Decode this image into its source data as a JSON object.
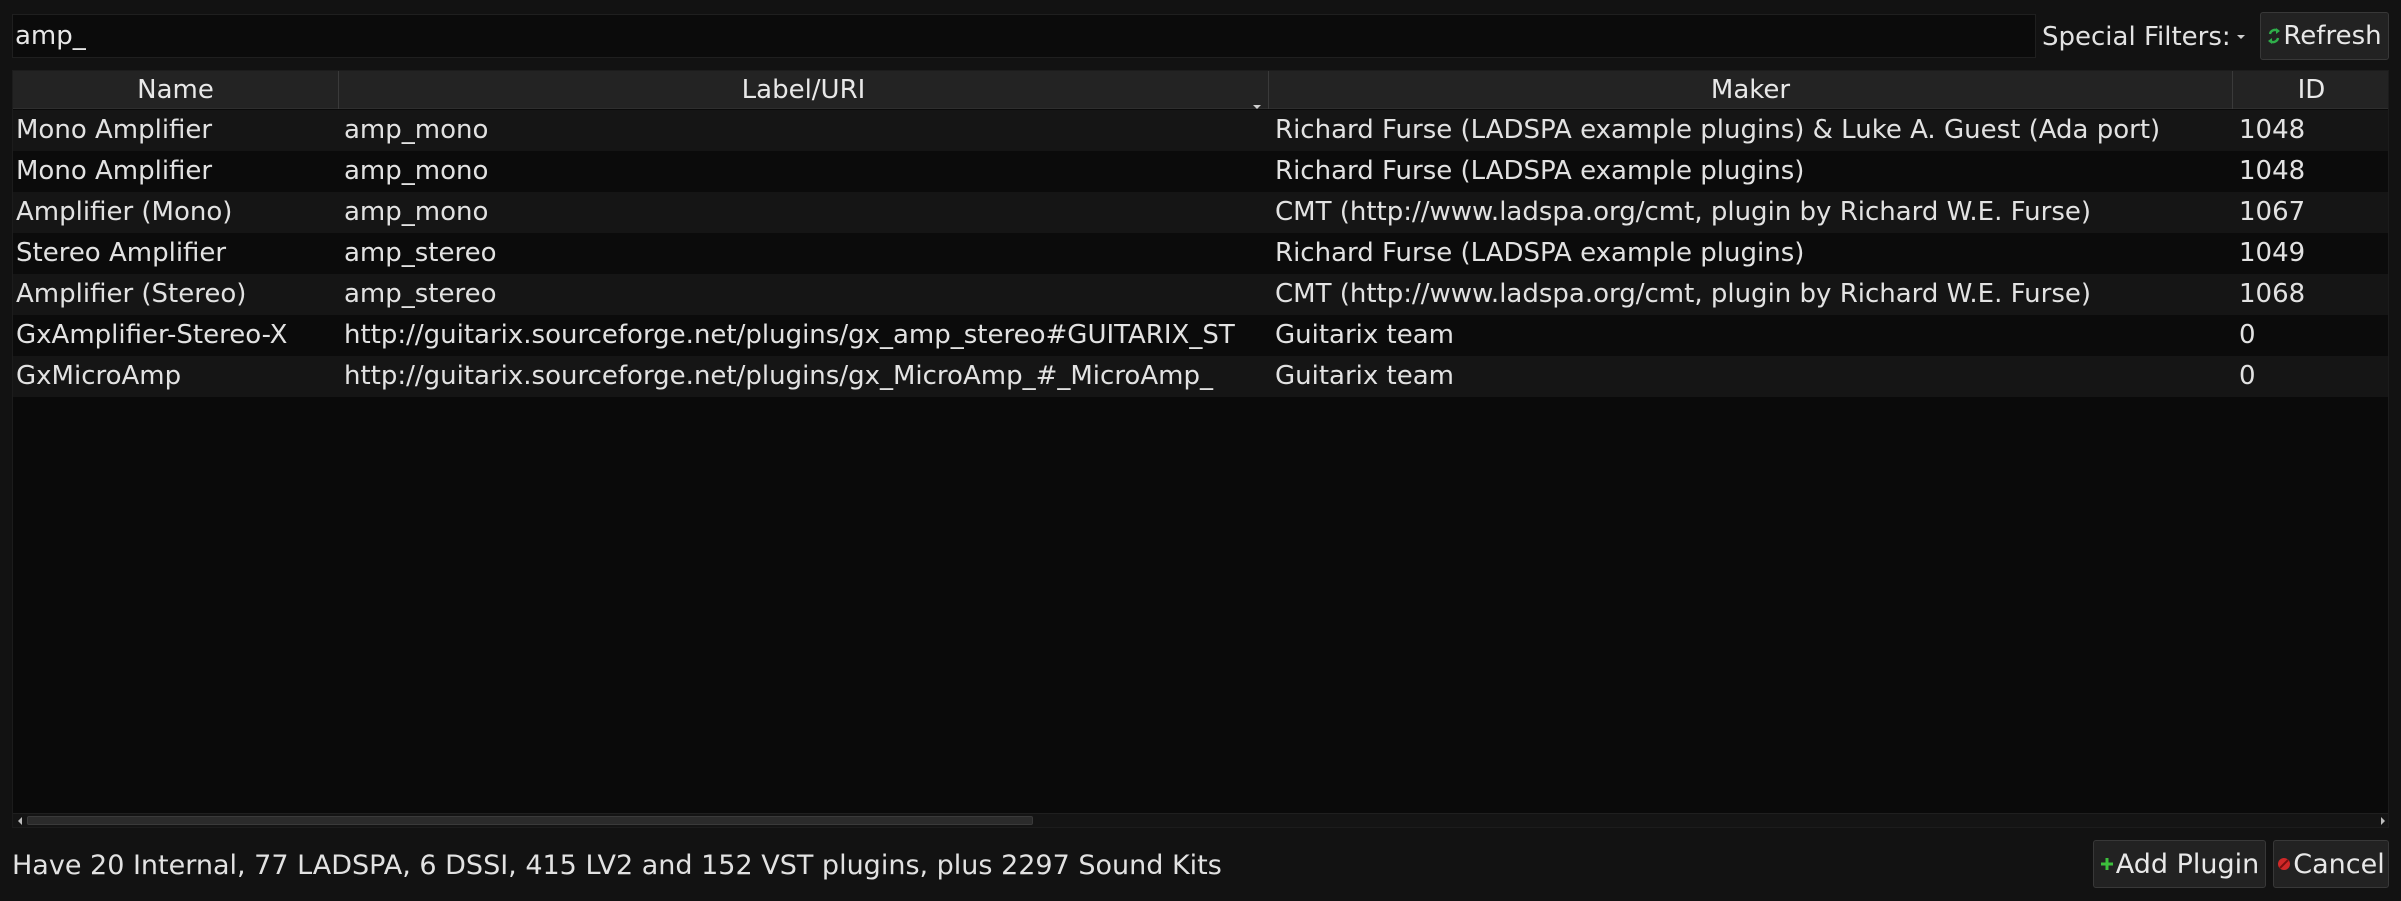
{
  "search": {
    "value": "amp_"
  },
  "filters": {
    "label": "Special Filters:",
    "icon": "chevron-down-icon"
  },
  "toolbar": {
    "refresh_label": "Refresh",
    "refresh_icon": "refresh-icon"
  },
  "table": {
    "columns": [
      "Name",
      "Label/URI",
      "Maker",
      "ID"
    ],
    "sorted_column": "Label/URI",
    "rows": [
      {
        "name": "Mono Amplifier",
        "label": "amp_mono",
        "maker": "Richard Furse (LADSPA example plugins) & Luke A. Guest (Ada port)",
        "id": "1048"
      },
      {
        "name": "Mono Amplifier",
        "label": "amp_mono",
        "maker": "Richard Furse (LADSPA example plugins)",
        "id": "1048"
      },
      {
        "name": "Amplifier (Mono)",
        "label": "amp_mono",
        "maker": "CMT (http://www.ladspa.org/cmt, plugin by Richard W.E. Furse)",
        "id": "1067"
      },
      {
        "name": "Stereo Amplifier",
        "label": "amp_stereo",
        "maker": "Richard Furse (LADSPA example plugins)",
        "id": "1049"
      },
      {
        "name": "Amplifier (Stereo)",
        "label": "amp_stereo",
        "maker": "CMT (http://www.ladspa.org/cmt, plugin by Richard W.E. Furse)",
        "id": "1068"
      },
      {
        "name": "GxAmplifier-Stereo-X",
        "label": "http://guitarix.sourceforge.net/plugins/gx_amp_stereo#GUITARIX_ST",
        "maker": "Guitarix team",
        "id": "0"
      },
      {
        "name": "GxMicroAmp",
        "label": "http://guitarix.sourceforge.net/plugins/gx_MicroAmp_#_MicroAmp_",
        "maker": "Guitarix team",
        "id": "0"
      }
    ]
  },
  "status": {
    "text": "Have 20 Internal, 77 LADSPA, 6 DSSI, 415 LV2 and 152 VST plugins, plus 2297 Sound Kits"
  },
  "actions": {
    "add_label": "Add Plugin",
    "add_icon": "plus-icon",
    "cancel_label": "Cancel",
    "cancel_icon": "cancel-icon"
  },
  "colors": {
    "add_icon": "#3cbf3c",
    "cancel_icon": "#d02828",
    "refresh_icon": "#2fae4a"
  }
}
